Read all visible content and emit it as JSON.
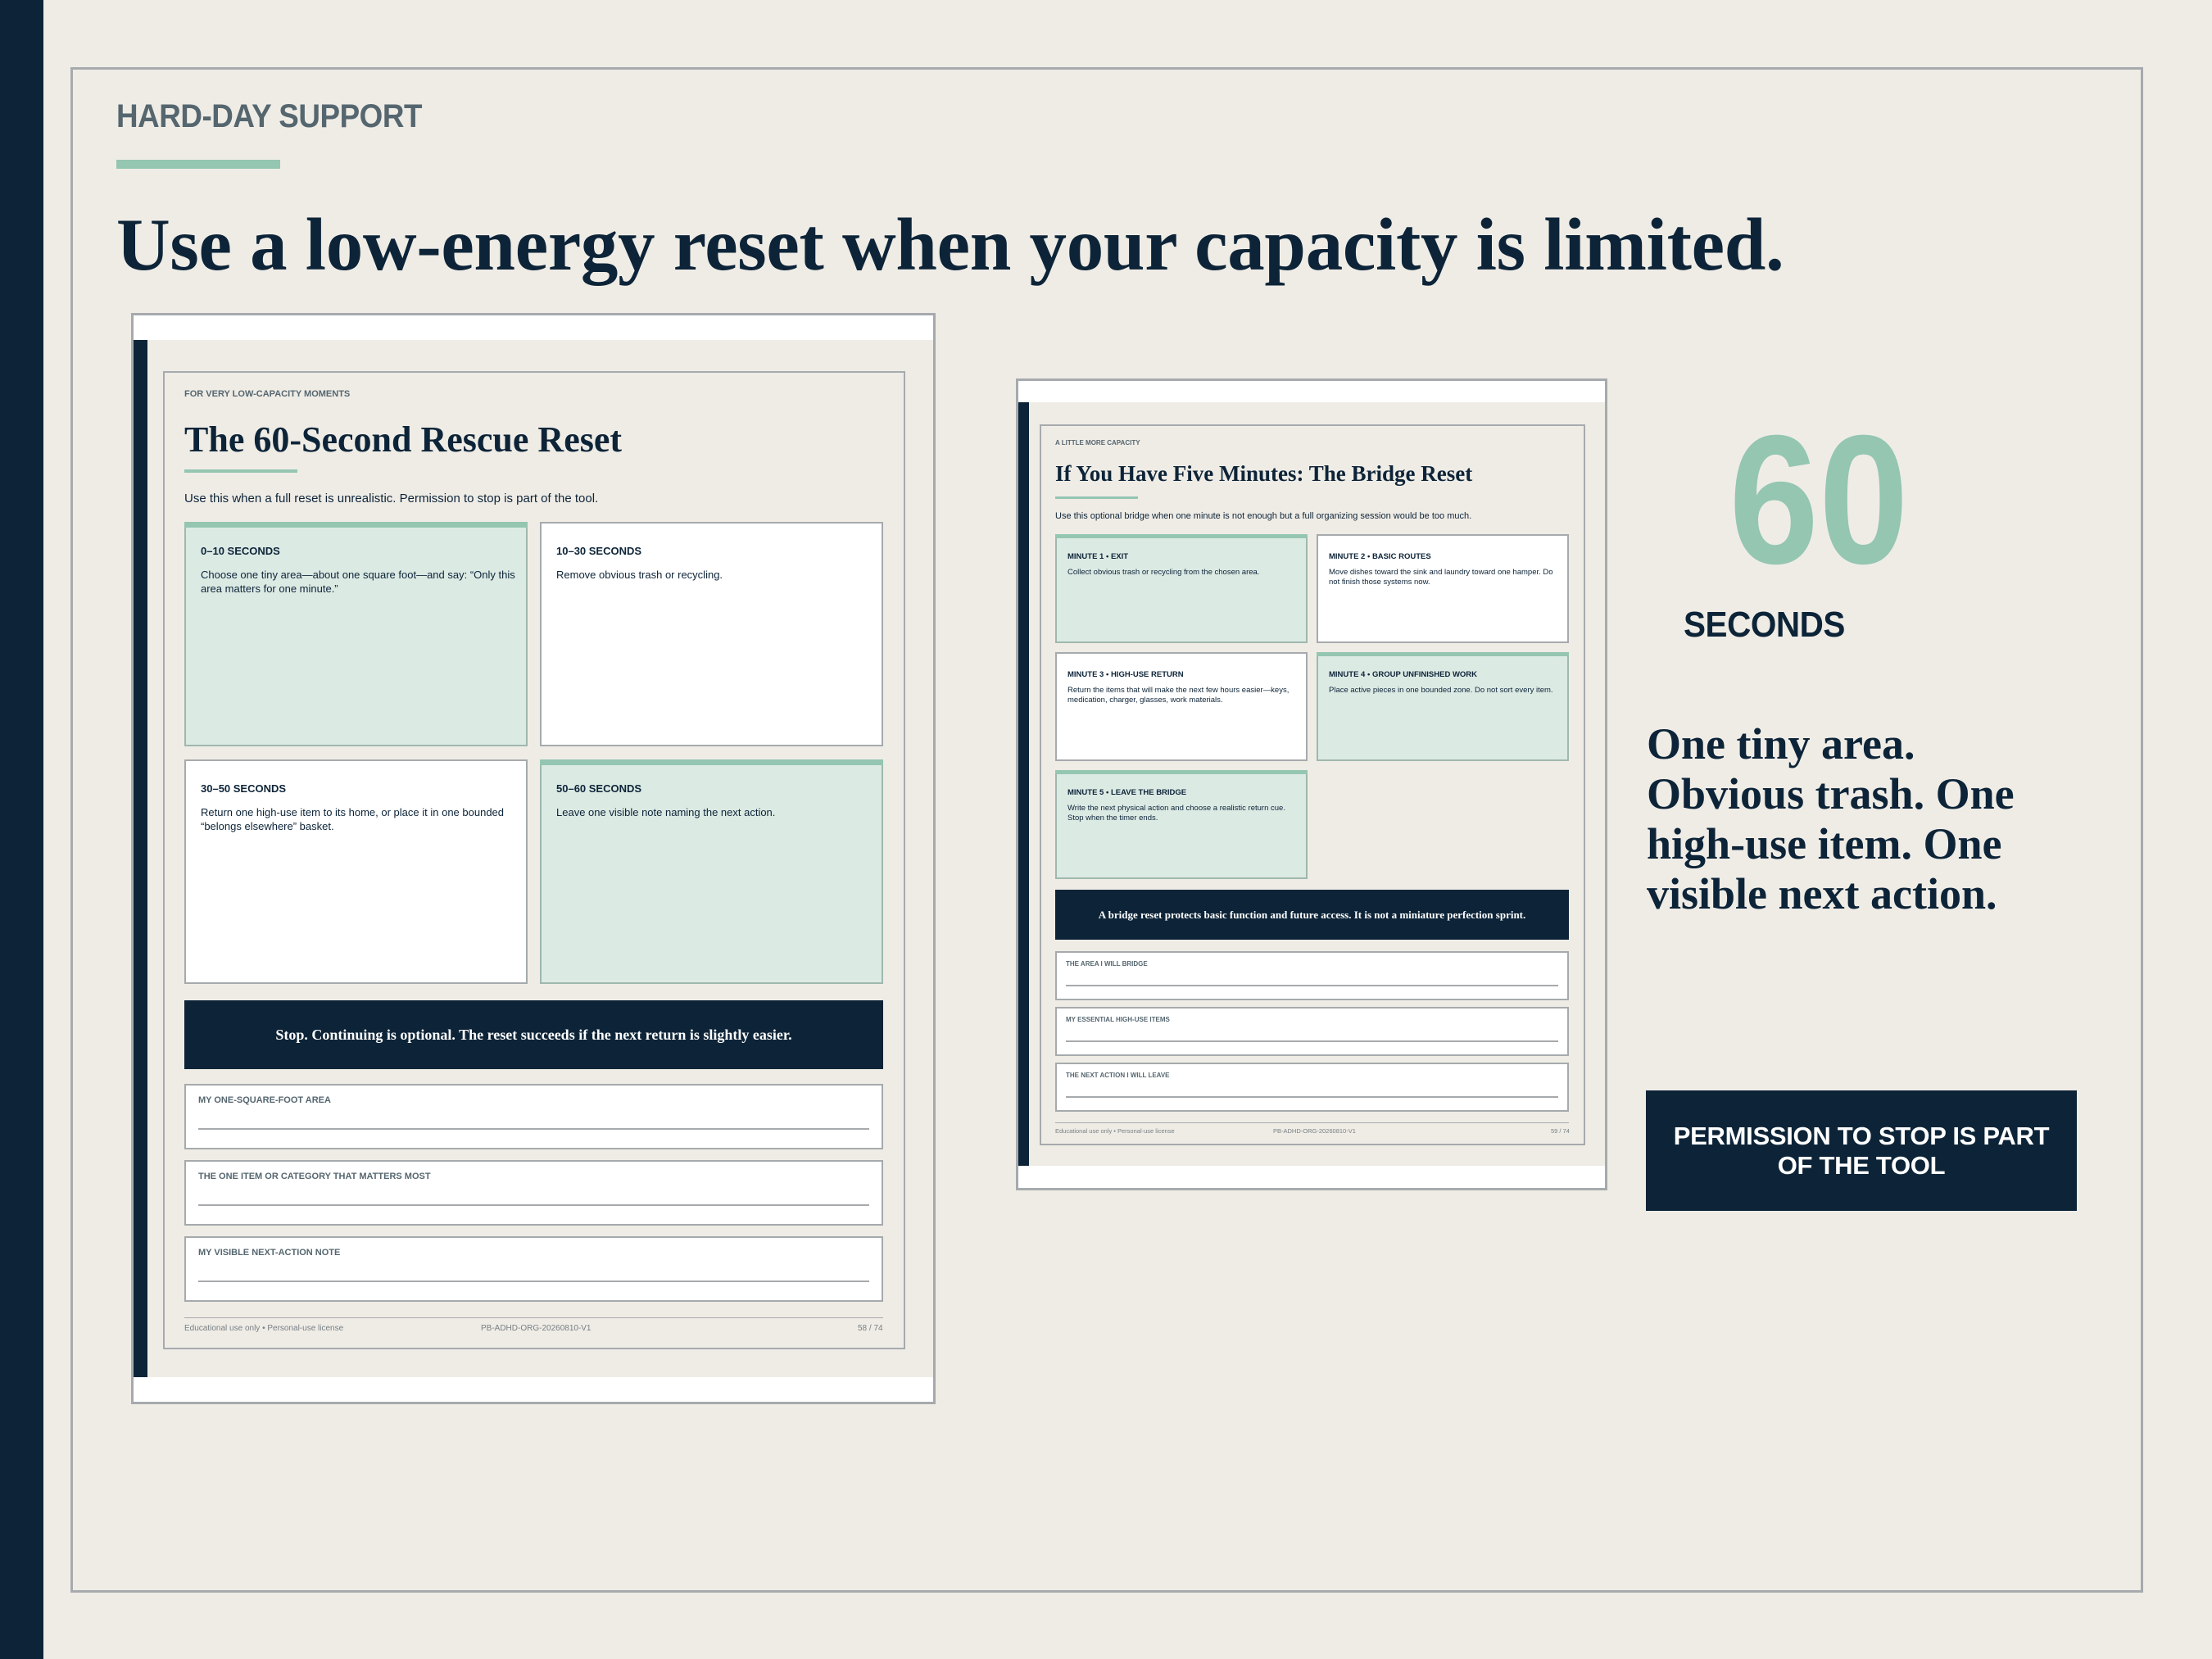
{
  "slide": {
    "eyebrow": "HARD-DAY SUPPORT",
    "headline": "Use a low-energy reset when your capacity is limited."
  },
  "page1": {
    "eyebrow": "FOR VERY LOW-CAPACITY MOMENTS",
    "title": "The 60-Second Rescue Reset",
    "intro": "Use this when a full reset is unrealistic. Permission to stop is part of the tool.",
    "cards": [
      {
        "title": "0–10 SECONDS",
        "body": "Choose one tiny area—about one square foot—and say: “Only this area matters for one minute.”"
      },
      {
        "title": "10–30 SECONDS",
        "body": "Remove obvious trash or recycling."
      },
      {
        "title": "30–50 SECONDS",
        "body": "Return one high-use item to its home, or place it in one bounded “belongs elsewhere” basket."
      },
      {
        "title": "50–60 SECONDS",
        "body": "Leave one visible note naming the next action."
      }
    ],
    "callout": "Stop. Continuing is optional. The reset succeeds if the next return is slightly easier.",
    "fields": [
      "MY ONE-SQUARE-FOOT AREA",
      "THE ONE ITEM OR CATEGORY THAT MATTERS MOST",
      "MY VISIBLE NEXT-ACTION NOTE"
    ],
    "footer": {
      "left": "Educational use only • Personal-use license",
      "center": "PB-ADHD-ORG-20260810-V1",
      "right": "58 / 74"
    }
  },
  "page2": {
    "eyebrow": "A LITTLE MORE CAPACITY",
    "title": "If You Have Five Minutes: The Bridge Reset",
    "intro": "Use this optional bridge when one minute is not enough but a full organizing session would be too much.",
    "cards": [
      {
        "title": "MINUTE 1 • EXIT",
        "body": "Collect obvious trash or recycling from the chosen area."
      },
      {
        "title": "MINUTE 2 • BASIC ROUTES",
        "body": "Move dishes toward the sink and laundry toward one hamper. Do not finish those systems now."
      },
      {
        "title": "MINUTE 3 • HIGH-USE RETURN",
        "body": "Return the items that will make the next few hours easier—keys, medication, charger, glasses, work materials."
      },
      {
        "title": "MINUTE 4 • GROUP UNFINISHED WORK",
        "body": "Place active pieces in one bounded zone. Do not sort every item."
      },
      {
        "title": "MINUTE 5 • LEAVE THE BRIDGE",
        "body": "Write the next physical action and choose a realistic return cue. Stop when the timer ends."
      }
    ],
    "callout": "A bridge reset protects basic function and future access. It is not a miniature perfection sprint.",
    "fields": [
      "THE AREA I WILL BRIDGE",
      "MY ESSENTIAL HIGH-USE ITEMS",
      "THE NEXT ACTION I WILL LEAVE"
    ],
    "footer": {
      "left": "Educational use only • Personal-use license",
      "center": "PB-ADHD-ORG-20260810-V1",
      "right": "59 / 74"
    }
  },
  "stat": {
    "number": "60",
    "unit": "SECONDS",
    "summary": "One tiny area. Obvious trash. One high-use item. One visible next action.",
    "permission": "PERMISSION TO STOP IS PART OF THE TOOL"
  }
}
